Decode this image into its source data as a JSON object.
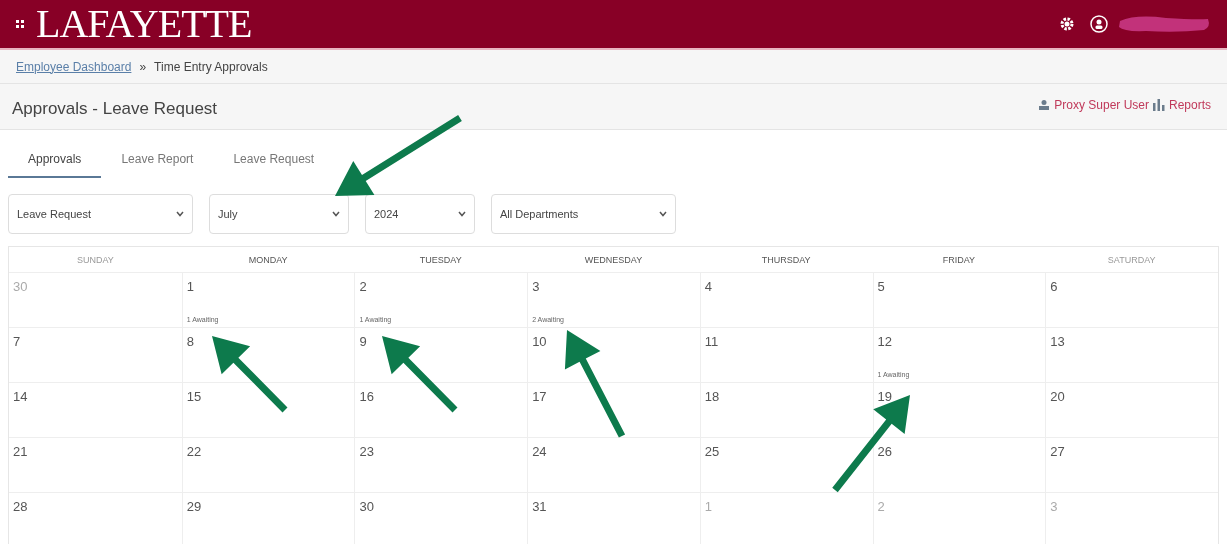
{
  "header": {
    "logo": "LAFAYETTE"
  },
  "breadcrumb": [
    {
      "label": "Employee Dashboard",
      "link": true
    },
    {
      "label": "»",
      "link": false
    },
    {
      "label": "Time Entry Approvals",
      "link": false
    }
  ],
  "page_title": "Approvals - Leave Request",
  "actions": [
    {
      "label": "Proxy Super User",
      "kind": "proxy"
    },
    {
      "label": "Reports",
      "kind": "reports"
    }
  ],
  "tabs": [
    {
      "label": "Approvals",
      "selected": true
    },
    {
      "label": "Leave Report",
      "selected": false
    },
    {
      "label": "Leave Request",
      "selected": false
    }
  ],
  "filters": [
    {
      "value": "Leave Request"
    },
    {
      "value": "July"
    },
    {
      "value": "2024"
    },
    {
      "value": "All Departments"
    }
  ],
  "calendar": {
    "days_of_week": [
      {
        "label": "SUNDAY",
        "weekend": true
      },
      {
        "label": "MONDAY",
        "weekend": false
      },
      {
        "label": "TUESDAY",
        "weekend": false
      },
      {
        "label": "WEDNESDAY",
        "weekend": false
      },
      {
        "label": "THURSDAY",
        "weekend": false
      },
      {
        "label": "FRIDAY",
        "weekend": false
      },
      {
        "label": "SATURDAY",
        "weekend": true
      }
    ],
    "weeks": [
      [
        {
          "day": "30",
          "in_month": false
        },
        {
          "day": "1",
          "in_month": true,
          "note": "1 Awaiting"
        },
        {
          "day": "2",
          "in_month": true,
          "note": "1 Awaiting"
        },
        {
          "day": "3",
          "in_month": true,
          "note": "2 Awaiting"
        },
        {
          "day": "4",
          "in_month": true
        },
        {
          "day": "5",
          "in_month": true
        },
        {
          "day": "6",
          "in_month": true
        }
      ],
      [
        {
          "day": "7",
          "in_month": true
        },
        {
          "day": "8",
          "in_month": true
        },
        {
          "day": "9",
          "in_month": true
        },
        {
          "day": "10",
          "in_month": true
        },
        {
          "day": "11",
          "in_month": true
        },
        {
          "day": "12",
          "in_month": true,
          "note": "1 Awaiting"
        },
        {
          "day": "13",
          "in_month": true
        }
      ],
      [
        {
          "day": "14",
          "in_month": true
        },
        {
          "day": "15",
          "in_month": true
        },
        {
          "day": "16",
          "in_month": true
        },
        {
          "day": "17",
          "in_month": true
        },
        {
          "day": "18",
          "in_month": true
        },
        {
          "day": "19",
          "in_month": true
        },
        {
          "day": "20",
          "in_month": true
        }
      ],
      [
        {
          "day": "21",
          "in_month": true
        },
        {
          "day": "22",
          "in_month": true
        },
        {
          "day": "23",
          "in_month": true
        },
        {
          "day": "24",
          "in_month": true
        },
        {
          "day": "25",
          "in_month": true
        },
        {
          "day": "26",
          "in_month": true
        },
        {
          "day": "27",
          "in_month": true
        }
      ],
      [
        {
          "day": "28",
          "in_month": true
        },
        {
          "day": "29",
          "in_month": true
        },
        {
          "day": "30",
          "in_month": true
        },
        {
          "day": "31",
          "in_month": true
        },
        {
          "day": "1",
          "in_month": false
        },
        {
          "day": "2",
          "in_month": false
        },
        {
          "day": "3",
          "in_month": false
        }
      ]
    ]
  }
}
